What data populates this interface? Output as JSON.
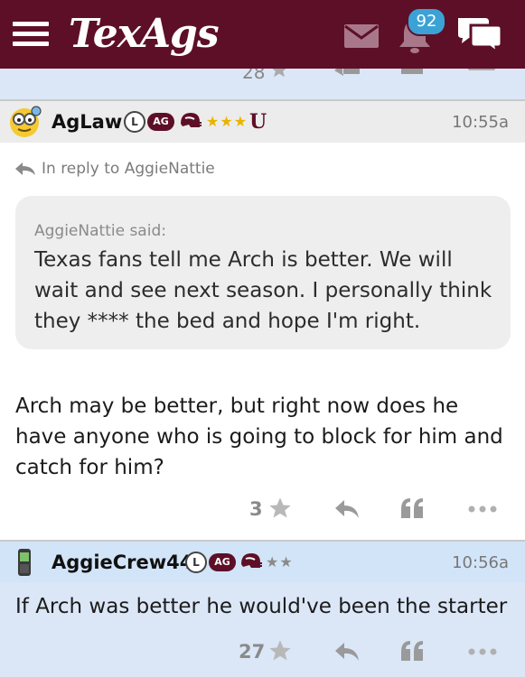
{
  "header": {
    "logo_text": "TexAgs",
    "notification_count": "92",
    "icons": [
      "menu-icon",
      "mail-icon",
      "bell-icon",
      "chat-bubbles-icon"
    ],
    "brand_color": "#5e0f28",
    "badge_color": "#3ba2d6"
  },
  "previous_post": {
    "like_count_partial": "28"
  },
  "posts": [
    {
      "username": "AgLaw",
      "badge_l": "L",
      "badge_ag": "AG",
      "stars": "★★★",
      "star_color": "#e8b400",
      "extra_badge": "U",
      "time": "10:55a",
      "reply_to": "In reply to AggieNattie",
      "quote_author": "AggieNattie said:",
      "quote_text": "Texas fans tell me Arch is better. We will wait and see next season. I personally think they **** the bed and hope I'm right.",
      "body": "Arch may be better, but right now does he have anyone who is going to block for him and catch for him?",
      "likes": "3"
    },
    {
      "username": "AggieCrew44",
      "badge_l": "L",
      "badge_ag": "AG",
      "stars": "★★",
      "star_color": "#8a8a8a",
      "time": "10:56a",
      "body": "If Arch was better he would've been the starter",
      "likes": "27"
    }
  ]
}
